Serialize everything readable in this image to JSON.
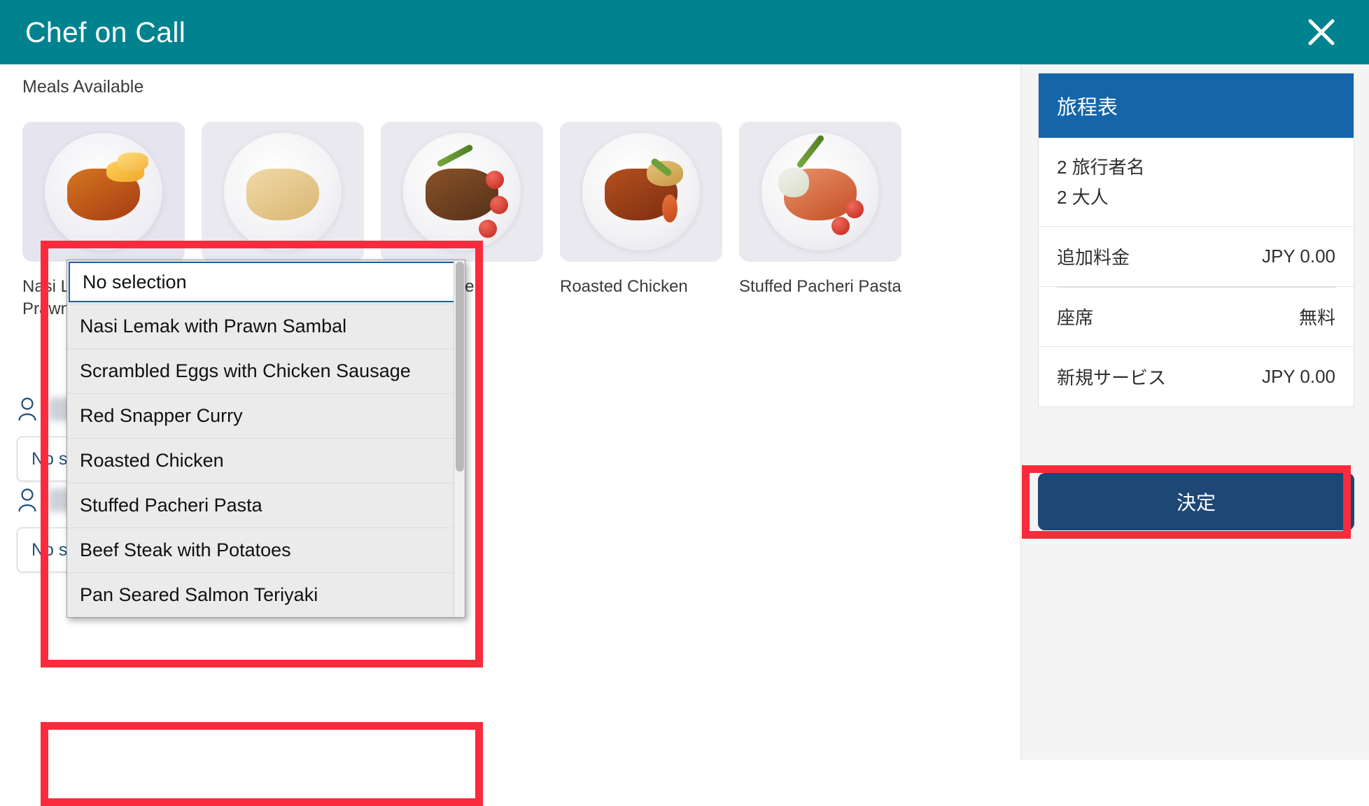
{
  "header": {
    "title": "Chef on Call",
    "close_icon": "close-icon",
    "bg_color": "#00838F"
  },
  "main": {
    "section_title": "Meals Available",
    "meals": [
      {
        "name": "Nasi Lemak with Prawn Sambal"
      },
      {
        "name": "Scrambled Eggs with Chicken Sausage"
      },
      {
        "name": "Red Snapper"
      },
      {
        "name": "Roasted Chicken"
      },
      {
        "name": "Stuffed Pacheri Pasta"
      }
    ],
    "meal_card_2_caption": "Beef Steak with Potatoes",
    "passengers": [
      {
        "name_redacted": true,
        "selected_meal": "No selection"
      },
      {
        "name_redacted": true,
        "selected_meal": "No selection"
      }
    ],
    "select_placeholder": "No selection",
    "chevron_icon": "chevron-down-icon",
    "person_icon": "person-icon"
  },
  "dropdown": {
    "open": true,
    "highlighted_option": "No selection",
    "options": [
      "No selection",
      "Nasi Lemak with Prawn Sambal",
      "Scrambled Eggs with Chicken Sausage",
      "Red Snapper Curry",
      "Roasted Chicken",
      "Stuffed Pacheri Pasta",
      "Beef Steak with Potatoes",
      "Pan Seared Salmon Teriyaki"
    ]
  },
  "sidebar": {
    "itinerary_title": "旅程表",
    "header_color": "#1565AB",
    "passenger_count_label": "2 旅行者名",
    "passenger_count_value": "2",
    "passenger_count_text": "旅行者名",
    "adults_label": "2 大人",
    "rows": [
      {
        "label": "追加料金",
        "value": "JPY 0.00"
      },
      {
        "label": "座席",
        "value": "無料"
      },
      {
        "label": "新規サービス",
        "value": "JPY 0.00"
      }
    ],
    "confirm_label": "決定",
    "confirm_color": "#1D4775"
  },
  "annotations": {
    "highlight_color": "#FB2A3C",
    "boxes": [
      "meal-dropdown-region",
      "second-passenger-select",
      "confirm-button"
    ]
  }
}
